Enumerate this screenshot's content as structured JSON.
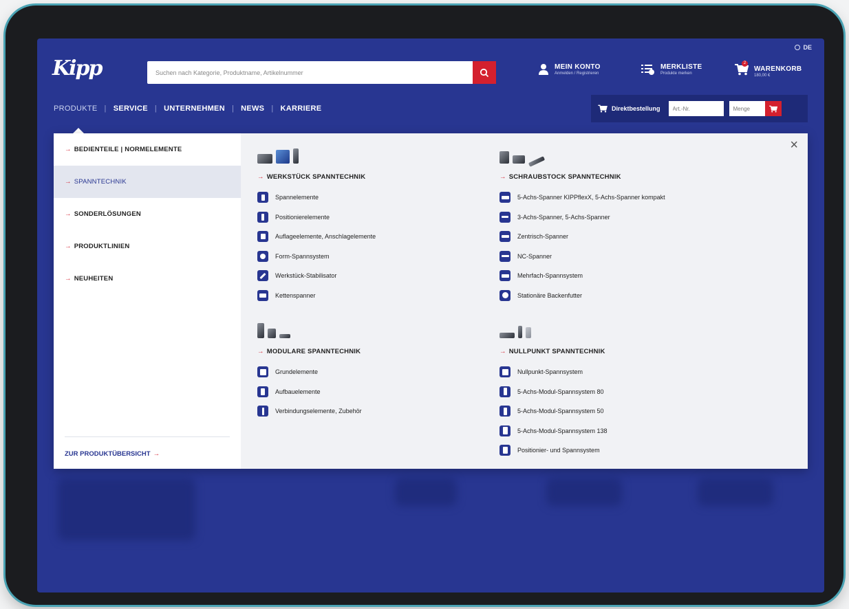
{
  "header": {
    "logo": "Kipp",
    "language": "DE",
    "search_placeholder": "Suchen nach Kategorie, Produktname, Artikelnummer",
    "account": {
      "title": "MEIN KONTO",
      "subtitle": "Anmelden / Registrieren"
    },
    "wishlist": {
      "title": "MERKLISTE",
      "subtitle": "Produkte merken"
    },
    "cart": {
      "title": "WARENKORB",
      "amount": "180,00 €",
      "count": "2"
    }
  },
  "nav": {
    "items": [
      "PRODUKTE",
      "SERVICE",
      "UNTERNEHMEN",
      "NEWS",
      "KARRIERE"
    ],
    "separator": "|"
  },
  "quick_order": {
    "label": "Direktbestellung",
    "article_placeholder": "Art.-Nr.",
    "quantity_placeholder": "Menge"
  },
  "mega_menu": {
    "sidebar": {
      "items": [
        "BEDIENTEILE | NORMELEMENTE",
        "SPANNTECHNIK",
        "SONDERLÖSUNGEN",
        "PRODUKTLINIEN",
        "NEUHEITEN"
      ],
      "active_index": 1,
      "footer_link": "ZUR PRODUKTÜBERSICHT"
    },
    "close_symbol": "×",
    "arrow": "→",
    "groups": [
      {
        "title": "WERKSTÜCK SPANNTECHNIK",
        "items": [
          "Spannelemente",
          "Positionierelemente",
          "Auflageelemente, Anschlagelemente",
          "Form-Spannsystem",
          "Werkstück-Stabilisator",
          "Kettenspanner"
        ]
      },
      {
        "title": "SCHRAUBSTOCK SPANNTECHNIK",
        "items": [
          "5-Achs-Spanner KIPPflexX, 5-Achs-Spanner kompakt",
          "3-Achs-Spanner, 5-Achs-Spanner",
          "Zentrisch-Spanner",
          "NC-Spanner",
          "Mehrfach-Spannsystem",
          "Stationäre Backenfutter"
        ]
      },
      {
        "title": "MODULARE SPANNTECHNIK",
        "items": [
          "Grundelemente",
          "Aufbauelemente",
          "Verbindungselemente, Zubehör"
        ]
      },
      {
        "title": "NULLPUNKT SPANNTECHNIK",
        "items": [
          "Nullpunkt-Spannsystem",
          "5-Achs-Modul-Spannsystem 80",
          "5-Achs-Modul-Spannsystem 50",
          "5-Achs-Modul-Spannsystem 138",
          "Positionier- und Spannsystem"
        ]
      }
    ]
  },
  "colors": {
    "brand_blue": "#283691",
    "accent_red": "#d4202e"
  }
}
